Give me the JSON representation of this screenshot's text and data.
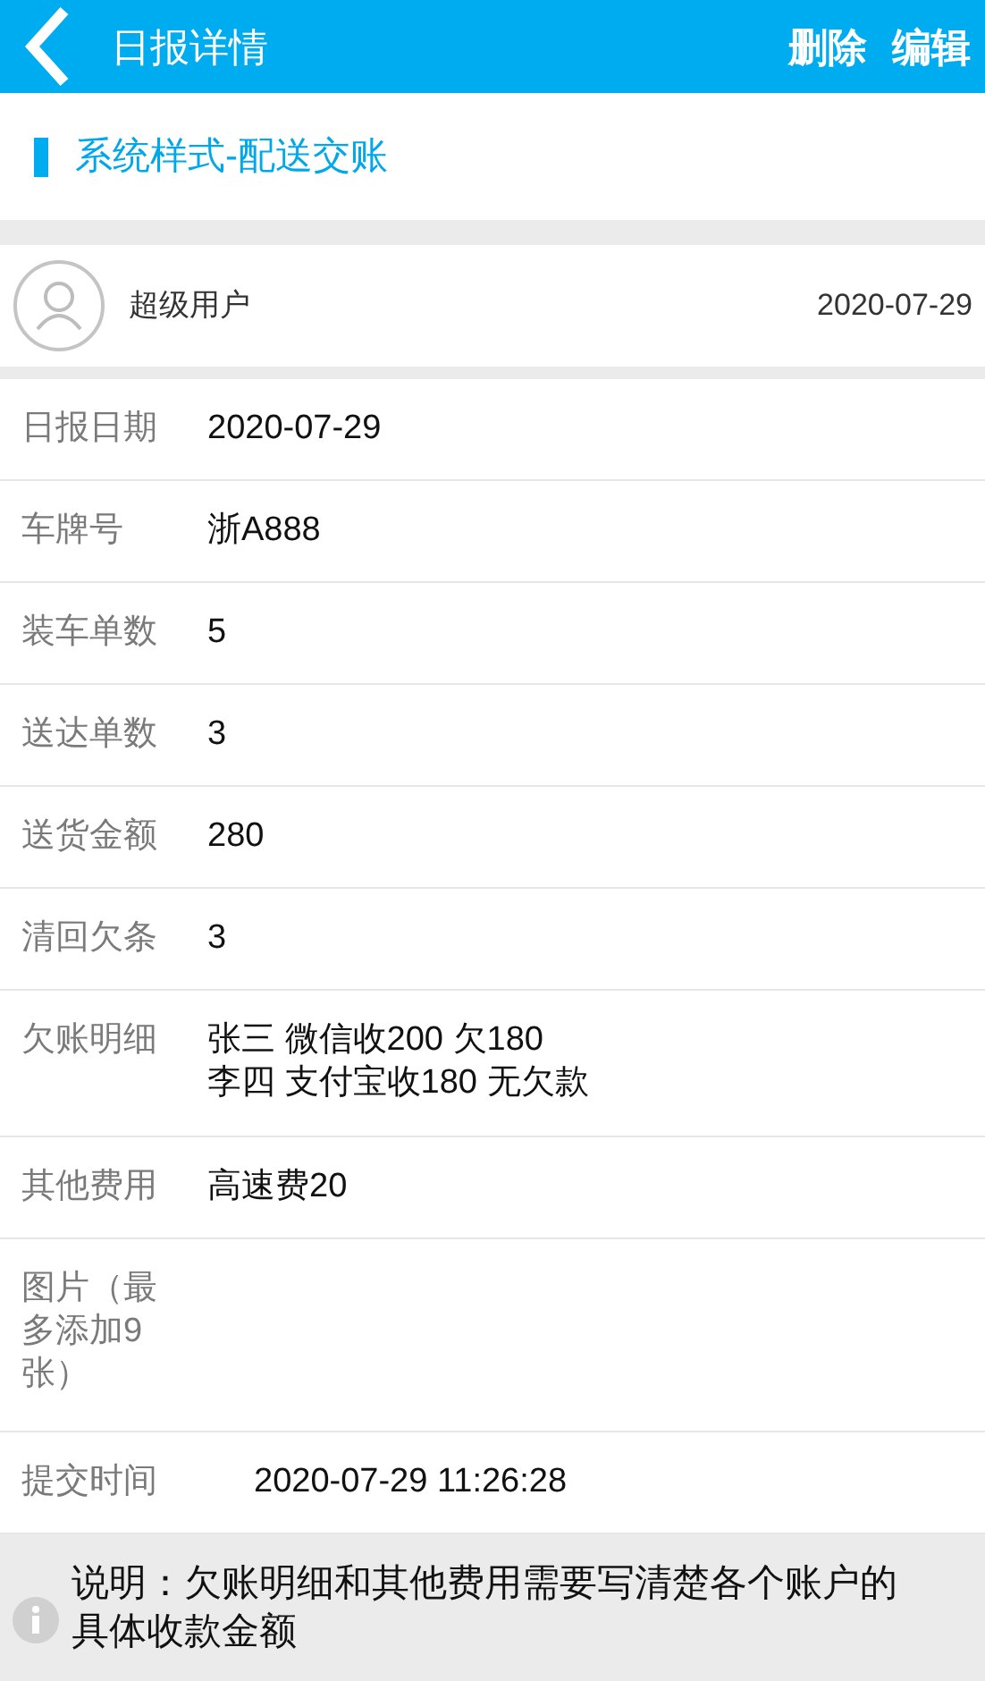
{
  "header": {
    "title": "日报详情",
    "actions": [
      "删除",
      "编辑"
    ]
  },
  "section_title": "系统样式-配送交账",
  "user": {
    "name": "超级用户",
    "date": "2020-07-29"
  },
  "rows": [
    {
      "kind": "field",
      "label": "日报日期",
      "lines": [
        "2020-07-29"
      ]
    },
    {
      "kind": "field",
      "label": "车牌号",
      "lines": [
        "浙A888"
      ]
    },
    {
      "kind": "field",
      "label": "装车单数",
      "lines": [
        "5"
      ]
    },
    {
      "kind": "field",
      "label": "送达单数",
      "lines": [
        "3"
      ]
    },
    {
      "kind": "field",
      "label": "送货金额",
      "lines": [
        "280"
      ]
    },
    {
      "kind": "field",
      "label": "清回欠条",
      "lines": [
        "3"
      ]
    },
    {
      "kind": "field",
      "label": "欠账明细",
      "lines": [
        "张三 微信收200 欠180",
        "李四 支付宝收180 无欠款"
      ]
    },
    {
      "kind": "field",
      "label": "其他费用",
      "lines": [
        "高速费20"
      ]
    },
    {
      "kind": "images",
      "label": "图片（最多添加9张）",
      "lines": []
    },
    {
      "kind": "time",
      "label": "提交时间",
      "lines": [
        "2020-07-29 11:26:28"
      ]
    }
  ],
  "notice": "说明：欠账明细和其他费用需要写清楚各个账户的具体收款金额"
}
